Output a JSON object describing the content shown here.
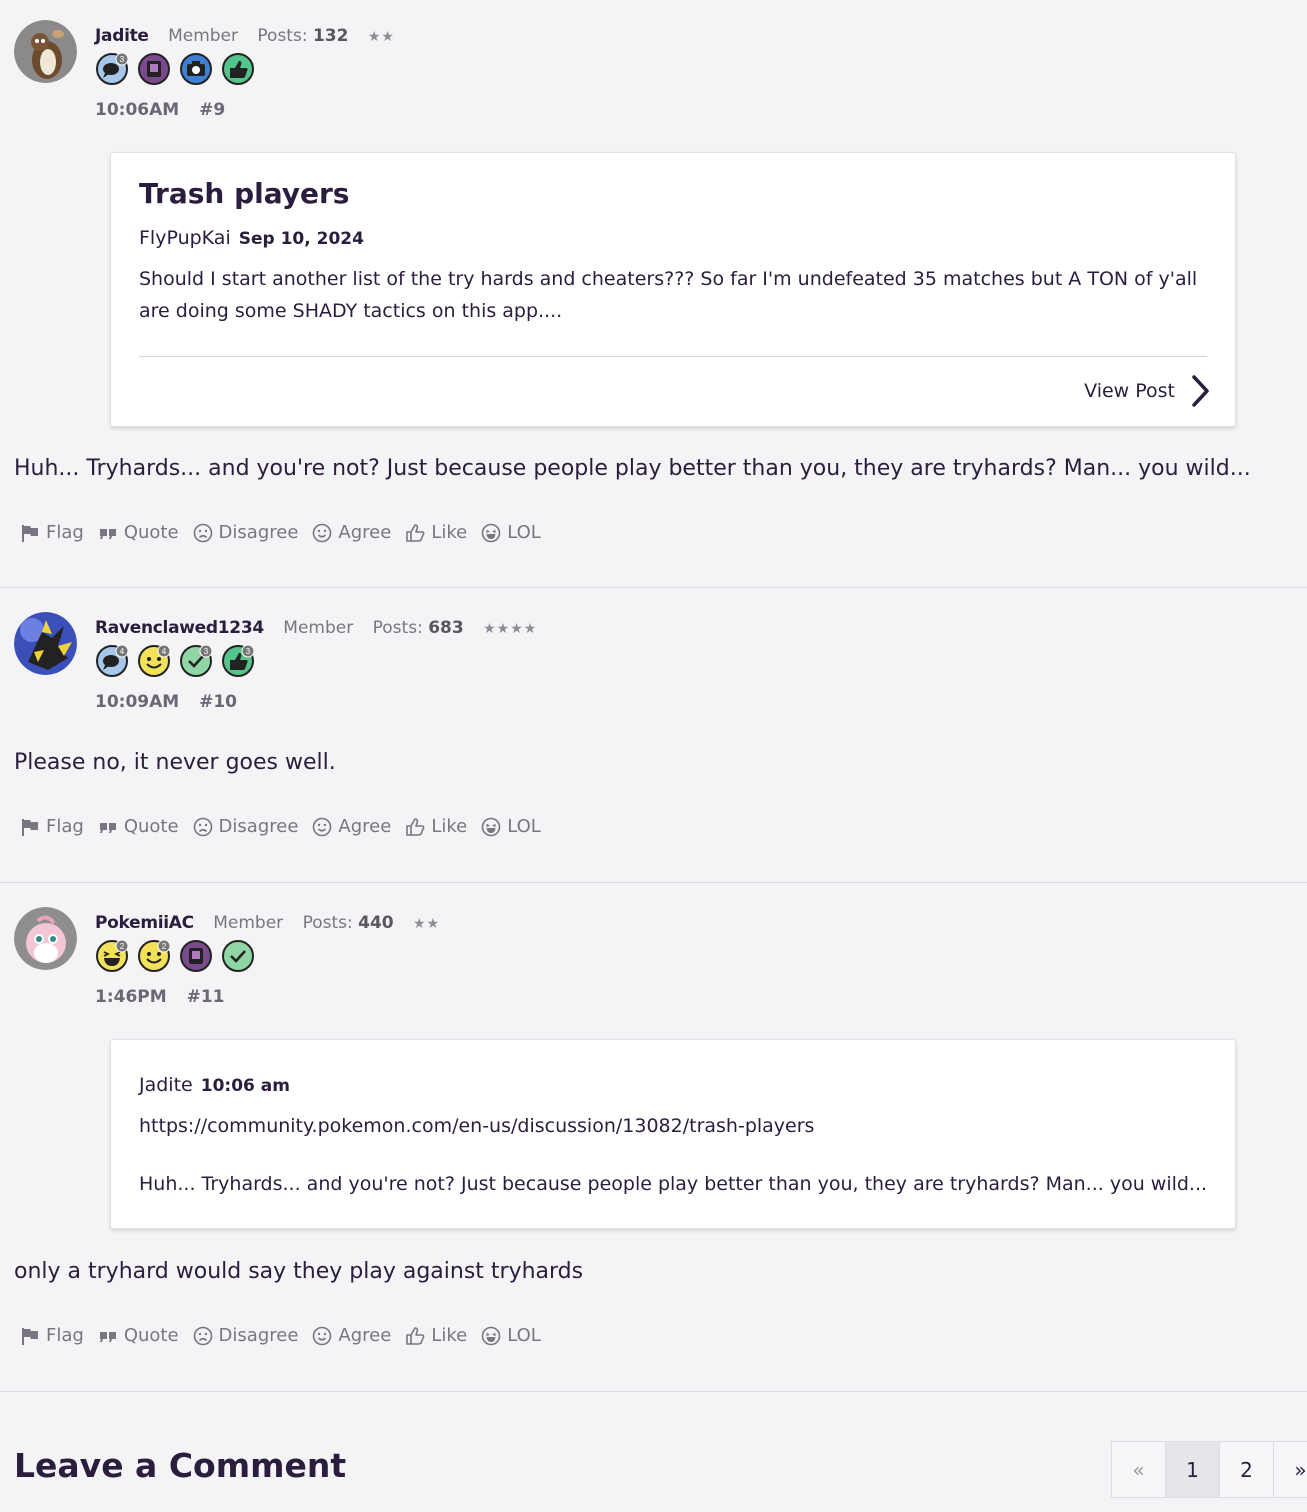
{
  "actions": [
    "Flag",
    "Quote",
    "Disagree",
    "Agree",
    "Like",
    "LOL"
  ],
  "posts": [
    {
      "username": "Jadite",
      "role": "Member",
      "posts_label": "Posts:",
      "posts_count": "132",
      "stars": "★★",
      "badges": [
        {
          "icon": "speech-bubble-badge-icon",
          "color": "#a6c8ea",
          "count": "3"
        },
        {
          "icon": "photo-frame-badge-icon",
          "color": "#7b4a8c"
        },
        {
          "icon": "camera-badge-icon",
          "color": "#3f7fd4"
        },
        {
          "icon": "thumbs-up-badge-icon",
          "color": "#54c48a"
        }
      ],
      "time": "10:06AM",
      "number": "#9",
      "shared_card": {
        "title": "Trash players",
        "author": "FlyPupKai",
        "date": "Sep 10, 2024",
        "body": "Should I start another list of the try hards and cheaters??? So far I'm undefeated 35 matches but A TON of y'all are doing some SHADY tactics on this app....",
        "view_label": "View Post"
      },
      "body": "Huh... Tryhards... and you're not? Just because people play better than you, they are tryhards? Man... you wild..."
    },
    {
      "username": "Ravenclawed1234",
      "role": "Member",
      "posts_label": "Posts:",
      "posts_count": "683",
      "stars": "★★★★",
      "badges": [
        {
          "icon": "speech-bubble-badge-icon",
          "color": "#a6c8ea",
          "count": "4"
        },
        {
          "icon": "smiley-badge-icon",
          "color": "#f4e15a",
          "count": "4"
        },
        {
          "icon": "check-badge-icon",
          "color": "#8fd6a4",
          "count": "3"
        },
        {
          "icon": "thumbs-up-badge-icon",
          "color": "#54c48a",
          "count": "3"
        }
      ],
      "time": "10:09AM",
      "number": "#10",
      "body": "Please no, it never goes well."
    },
    {
      "username": "PokemiiAC",
      "role": "Member",
      "posts_label": "Posts:",
      "posts_count": "440",
      "stars": "★★",
      "badges": [
        {
          "icon": "laughing-badge-icon",
          "color": "#f4e15a",
          "count": "2"
        },
        {
          "icon": "smiley-badge-icon",
          "color": "#f4e15a",
          "count": "2"
        },
        {
          "icon": "photo-frame-badge-icon",
          "color": "#7b4a8c"
        },
        {
          "icon": "check-badge-icon",
          "color": "#8fd6a4"
        }
      ],
      "time": "1:46PM",
      "number": "#11",
      "quote": {
        "author": "Jadite",
        "time": "10:06 am",
        "link": "https://community.pokemon.com/en-us/discussion/13082/trash-players",
        "text": "Huh... Tryhards... and you're not? Just because people play better than you, they are tryhards? Man... you wild..."
      },
      "body": "only a tryhard would say they play against tryhards"
    }
  ],
  "leave_comment": "Leave a Comment",
  "pagination": {
    "prev": "«",
    "pages": [
      "1",
      "2"
    ],
    "next": "»",
    "current": "1"
  }
}
